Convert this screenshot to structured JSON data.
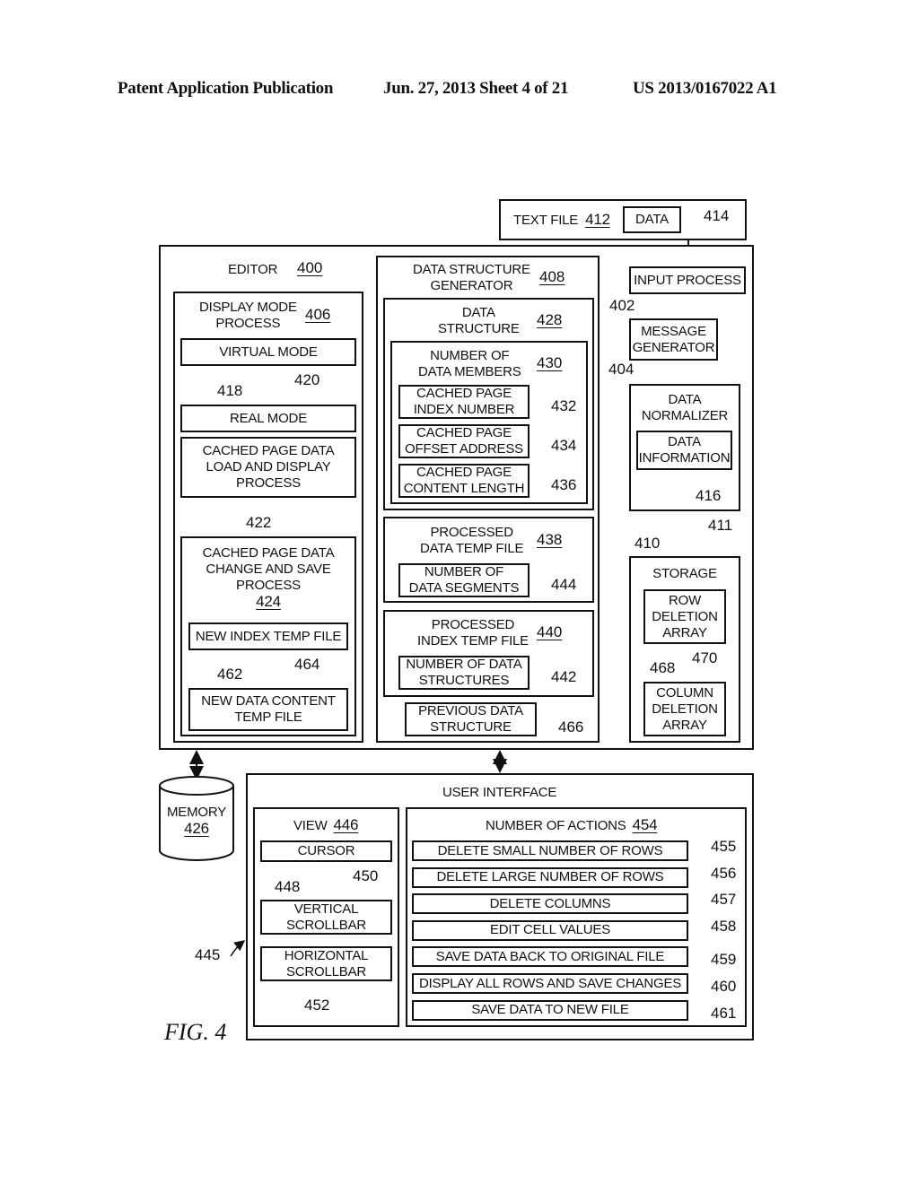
{
  "header": {
    "left": "Patent Application Publication",
    "middle": "Jun. 27, 2013  Sheet 4 of 21",
    "right": "US 2013/0167022 A1"
  },
  "text_file": {
    "label": "TEXT FILE",
    "ref": "412",
    "data_label": "DATA",
    "data_ref": "414"
  },
  "editor": {
    "label": "EDITOR",
    "ref": "400",
    "display_mode": {
      "label_line1": "DISPLAY MODE",
      "label_line2": "PROCESS",
      "ref": "406",
      "virtual_mode": "VIRTUAL MODE",
      "virtual_ref": "418",
      "real_mode": "REAL MODE",
      "real_ref": "420",
      "load_line1": "CACHED PAGE DATA",
      "load_line2": "LOAD AND DISPLAY",
      "load_line3": "PROCESS",
      "load_ref": "422",
      "change": {
        "line1": "CACHED PAGE DATA",
        "line2": "CHANGE AND SAVE",
        "line3": "PROCESS",
        "ref": "424",
        "index_temp": "NEW INDEX TEMP FILE",
        "index_ref": "462",
        "content_line1": "NEW DATA CONTENT",
        "content_line2": "TEMP FILE",
        "content_ref": "464"
      }
    },
    "generator": {
      "line1": "DATA STRUCTURE",
      "line2": "GENERATOR",
      "ref": "408",
      "structure": {
        "line1": "DATA",
        "line2": "STRUCTURE",
        "ref": "428",
        "members": {
          "line1": "NUMBER OF",
          "line2": "DATA MEMBERS",
          "ref": "430",
          "items": [
            {
              "line1": "CACHED PAGE",
              "line2": "INDEX NUMBER",
              "ref": "432"
            },
            {
              "line1": "CACHED PAGE",
              "line2": "OFFSET ADDRESS",
              "ref": "434"
            },
            {
              "line1": "CACHED PAGE",
              "line2": "CONTENT LENGTH",
              "ref": "436"
            }
          ]
        }
      },
      "data_temp": {
        "line1": "PROCESSED",
        "line2": "DATA TEMP FILE",
        "ref": "438",
        "sub_line1": "NUMBER OF",
        "sub_line2": "DATA SEGMENTS",
        "sub_ref": "444"
      },
      "index_temp": {
        "line1": "PROCESSED",
        "line2": "INDEX TEMP FILE",
        "ref": "440",
        "sub_line1": "NUMBER OF DATA",
        "sub_line2": "STRUCTURES",
        "sub_ref": "442"
      },
      "previous": {
        "line1": "PREVIOUS DATA",
        "line2": "STRUCTURE",
        "ref": "466"
      }
    },
    "input_process": {
      "label": "INPUT PROCESS",
      "ref": "402"
    },
    "message_generator": {
      "line1": "MESSAGE",
      "line2": "GENERATOR",
      "ref": "404"
    },
    "normalizer": {
      "line1": "DATA",
      "line2": "NORMALIZER",
      "info_line1": "DATA",
      "info_line2": "INFORMATION",
      "info_ref": "416",
      "ref": "410",
      "arrow_ref": "411"
    },
    "storage": {
      "label": "STORAGE",
      "row_line1": "ROW",
      "row_line2": "DELETION",
      "row_line3": "ARRAY",
      "row_ref": "468",
      "col_line1": "COLUMN",
      "col_line2": "DELETION",
      "col_line3": "ARRAY",
      "col_ref": "470"
    }
  },
  "memory": {
    "label": "MEMORY",
    "ref": "426"
  },
  "user_interface": {
    "label": "USER INTERFACE",
    "ref": "445",
    "view": {
      "label": "VIEW",
      "ref": "446",
      "cursor": "CURSOR",
      "cursor_ref": "448",
      "vscroll_line1": "VERTICAL",
      "vscroll_line2": "SCROLLBAR",
      "vscroll_ref": "450",
      "hscroll_line1": "HORIZONTAL",
      "hscroll_line2": "SCROLLBAR",
      "hscroll_ref": "452"
    },
    "actions": {
      "label": "NUMBER OF ACTIONS",
      "ref": "454",
      "items": [
        {
          "label": "DELETE SMALL NUMBER OF ROWS",
          "ref": "455"
        },
        {
          "label": "DELETE LARGE NUMBER OF ROWS",
          "ref": "456"
        },
        {
          "label": "DELETE COLUMNS",
          "ref": "457"
        },
        {
          "label": "EDIT CELL VALUES",
          "ref": "458"
        },
        {
          "label": "SAVE DATA BACK TO ORIGINAL FILE",
          "ref": "459"
        },
        {
          "label": "DISPLAY ALL ROWS AND SAVE CHANGES",
          "ref": "460"
        },
        {
          "label": "SAVE DATA TO NEW FILE",
          "ref": "461"
        }
      ]
    }
  },
  "figure_label": "FIG. 4"
}
